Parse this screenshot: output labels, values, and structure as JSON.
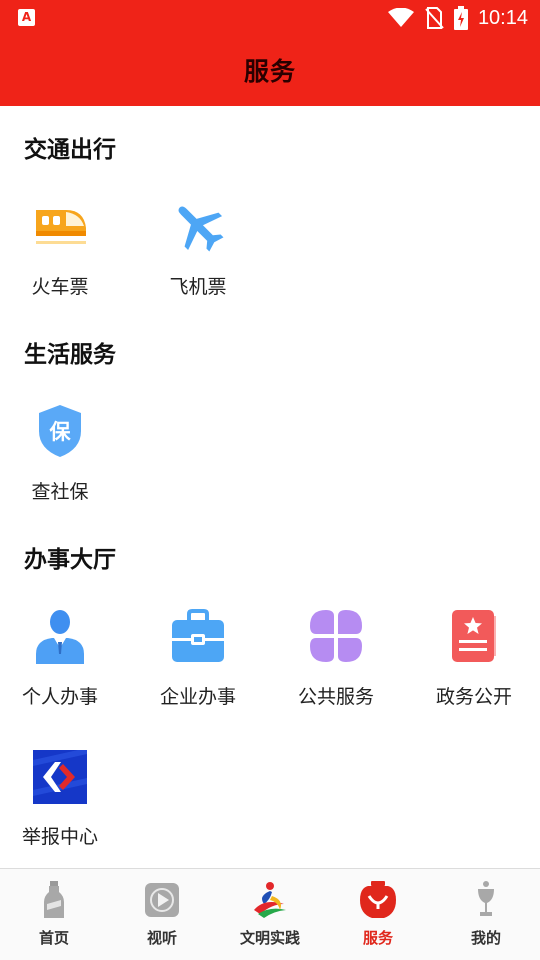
{
  "status_bar": {
    "time": "10:14",
    "app_icon_letter": "A",
    "icons": [
      "wifi-icon",
      "no-sim-icon",
      "battery-charging-icon"
    ]
  },
  "header": {
    "title": "服务"
  },
  "sections": [
    {
      "title": "交通出行",
      "items": [
        {
          "label": "火车票",
          "icon": "train-icon"
        },
        {
          "label": "飞机票",
          "icon": "airplane-icon"
        }
      ]
    },
    {
      "title": "生活服务",
      "items": [
        {
          "label": "查社保",
          "icon": "social-security-shield-icon"
        }
      ]
    },
    {
      "title": "办事大厅",
      "items": [
        {
          "label": "个人办事",
          "icon": "person-icon"
        },
        {
          "label": "企业办事",
          "icon": "briefcase-icon"
        },
        {
          "label": "公共服务",
          "icon": "clover-icon"
        },
        {
          "label": "政务公开",
          "icon": "notebook-star-icon"
        },
        {
          "label": "举报中心",
          "icon": "report-center-logo-icon"
        }
      ]
    }
  ],
  "bottom_nav": {
    "items": [
      {
        "label": "首页",
        "icon": "bottle-icon",
        "active": false
      },
      {
        "label": "视听",
        "icon": "play-icon",
        "active": false
      },
      {
        "label": "文明实践",
        "icon": "civilization-logo-icon",
        "active": false
      },
      {
        "label": "服务",
        "icon": "service-lantern-icon",
        "active": true
      },
      {
        "label": "我的",
        "icon": "goblet-icon",
        "active": false
      }
    ]
  },
  "colors": {
    "brand_red": "#ef2318",
    "active_tab": "#e0271c",
    "title_text": "#2a0000"
  }
}
